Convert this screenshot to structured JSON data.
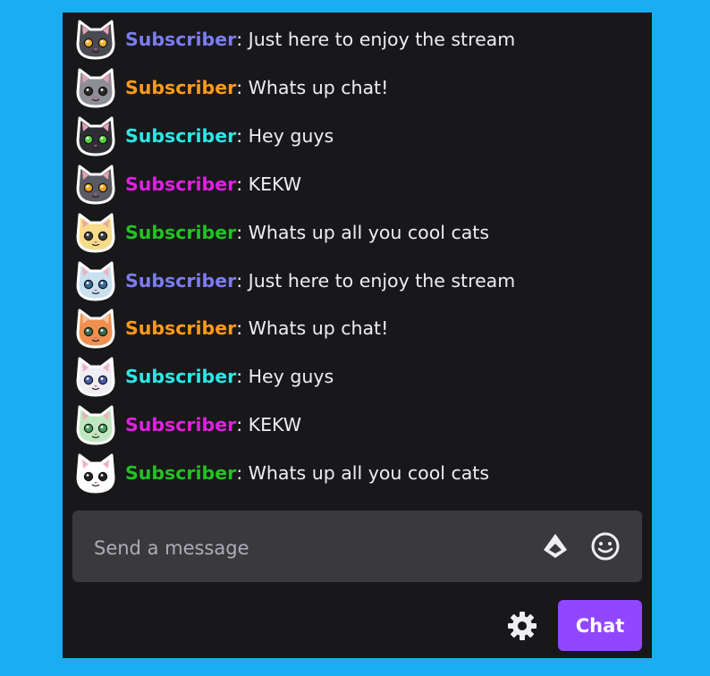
{
  "chat": {
    "messages": [
      {
        "user": "Subscriber",
        "text": ": Just here to enjoy the stream",
        "color": "#7c7cf0",
        "cat": {
          "fur": "#4a4a52",
          "inner": "#e8a0b4",
          "eye": "#f0b030"
        }
      },
      {
        "user": "Subscriber",
        "text": ": Whats up chat!",
        "color": "#ff9a1a",
        "cat": {
          "fur": "#8e8e96",
          "inner": "#e8a0b4",
          "eye": "#2a2a2a"
        }
      },
      {
        "user": "Subscriber",
        "text": ": Hey guys",
        "color": "#2ee6e6",
        "cat": {
          "fur": "#2e2e34",
          "inner": "#e8a0b4",
          "eye": "#58d040"
        }
      },
      {
        "user": "Subscriber",
        "text": ": KEKW",
        "color": "#e020e0",
        "cat": {
          "fur": "#5a5a62",
          "inner": "#e8a0b4",
          "eye": "#f0a020"
        }
      },
      {
        "user": "Subscriber",
        "text": ": Whats up all you cool cats",
        "color": "#22c222",
        "cat": {
          "fur": "#f6dc8a",
          "inner": "#f0a8a0",
          "eye": "#3a3a3a"
        }
      },
      {
        "user": "Subscriber",
        "text": ": Just here to enjoy the stream",
        "color": "#7c7cf0",
        "cat": {
          "fur": "#c8e0f0",
          "inner": "#f0b0c0",
          "eye": "#3a6a9a"
        }
      },
      {
        "user": "Subscriber",
        "text": ": Whats up chat!",
        "color": "#ff9a1a",
        "cat": {
          "fur": "#f09050",
          "inner": "#f8c0a0",
          "eye": "#3a6a4a"
        }
      },
      {
        "user": "Subscriber",
        "text": ": Hey guys",
        "color": "#2ee6e6",
        "cat": {
          "fur": "#eeeef4",
          "inner": "#f0b0c8",
          "eye": "#4a5ab0"
        }
      },
      {
        "user": "Subscriber",
        "text": ": KEKW",
        "color": "#e020e0",
        "cat": {
          "fur": "#c0e8c0",
          "inner": "#f0b0c0",
          "eye": "#4aa060"
        }
      },
      {
        "user": "Subscriber",
        "text": ": Whats up all you cool cats",
        "color": "#22c222",
        "cat": {
          "fur": "#ffffff",
          "inner": "#f0b0c0",
          "eye": "#222222"
        }
      }
    ]
  },
  "input": {
    "placeholder": "Send a message"
  },
  "icons": {
    "bits": "bits-icon",
    "emote": "emote-icon",
    "settings": "gear-icon"
  },
  "buttons": {
    "chat_label": "Chat"
  },
  "colors": {
    "accent": "#9147ff",
    "background": "#1aadf2",
    "panel": "#18181b",
    "input": "#3a3a3d"
  }
}
